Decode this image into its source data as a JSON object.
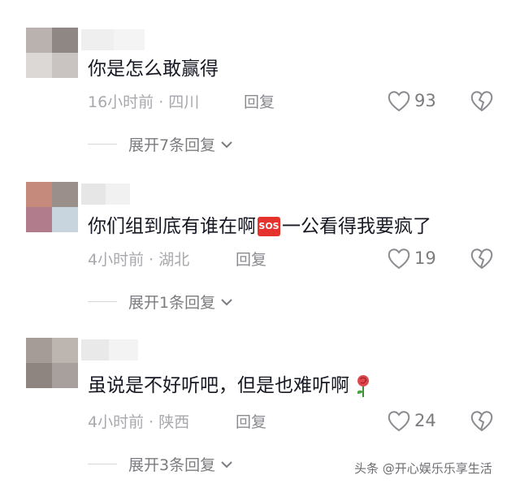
{
  "comments": [
    {
      "text": "你是怎么敢赢得",
      "time": "16小时前 · 四川",
      "reply_label": "回复",
      "likes": "93",
      "expand_label": "展开7条回复"
    },
    {
      "text_before": "你们组到底有谁在啊",
      "emoji_label": "SOS",
      "text_after": "一公看得我要疯了",
      "time": "4小时前 · 湖北",
      "reply_label": "回复",
      "likes": "19",
      "expand_label": "展开1条回复"
    },
    {
      "text": "虽说是不好听吧，但是也难听啊",
      "time": "4小时前 · 陕西",
      "reply_label": "回复",
      "likes": "24",
      "expand_label": "展开3条回复"
    }
  ],
  "watermark": "头条 @开心娱乐乐享生活",
  "colors": {
    "text": "#161823",
    "meta": "#a8a8ae",
    "icon": "#8a8a90",
    "sos_red": "#e5322d"
  }
}
